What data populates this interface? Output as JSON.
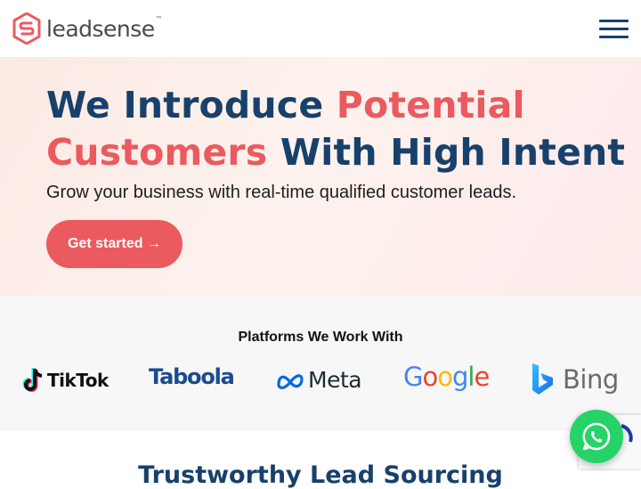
{
  "header": {
    "brand": "leadsense",
    "trademark": "™",
    "menu_icon": "hamburger-menu-icon"
  },
  "hero": {
    "headline_part1": "We Introduce ",
    "headline_accent1": "Potential",
    "headline_accent2": "Customers",
    "headline_part2": " With High Intent",
    "subtitle": "Grow your business with real-time qualified customer leads.",
    "cta_label": "Get started →"
  },
  "platforms": {
    "title": "Platforms We Work With",
    "logos": [
      {
        "name": "TikTok",
        "icon": "tiktok-icon"
      },
      {
        "name": "Taboola",
        "icon": "taboola-logo"
      },
      {
        "name": "Meta",
        "icon": "meta-icon"
      },
      {
        "name": "Google",
        "icon": "google-logo"
      },
      {
        "name": "Bing",
        "icon": "bing-icon"
      }
    ]
  },
  "next_section": {
    "title": "Trustworthy Lead Sourcing"
  },
  "floating": {
    "whatsapp_icon": "whatsapp-icon"
  },
  "colors": {
    "navy": "#17416b",
    "accent": "#ea5a5f",
    "whatsapp": "#25d366"
  }
}
